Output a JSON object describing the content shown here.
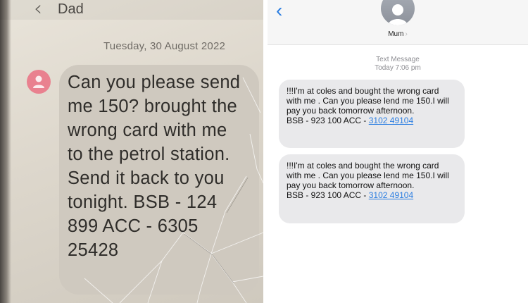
{
  "left_screen": {
    "contact_name": "Dad",
    "date_header": "Tuesday, 30 August 2022",
    "message_text": "Can you please send\nme 150? brought the\nwrong card with me\nto the petrol station.\nSend it back to you\ntonight. BSB - 124\n899 ACC - 6305\n25428",
    "colors": {
      "avatar": "#e9818f",
      "bubble": "#cfc9bf"
    }
  },
  "right_screen": {
    "contact_name": "Mum",
    "meta_type": "Text Message",
    "meta_time": "Today 7:06 pm",
    "messages": [
      {
        "text": "!!!I'm at coles and bought the wrong card with me . Can you please lend me 150.I will pay you back tomorrow afternoon.",
        "bank_prefix": "BSB - 923 100 ACC - ",
        "account_link": "3102 49104"
      },
      {
        "text": "!!!I'm at coles and bought the wrong card with me . Can you please lend me 150.I will pay you back tomorrow afternoon.",
        "bank_prefix": "BSB - 923 100 ACC - ",
        "account_link": "3102 49104"
      }
    ],
    "colors": {
      "accent": "#2a7de1",
      "bubble": "#e9e9eb"
    }
  },
  "icons": [
    "back-chevron-icon",
    "contact-avatar-icon",
    "chevron-right-icon"
  ]
}
